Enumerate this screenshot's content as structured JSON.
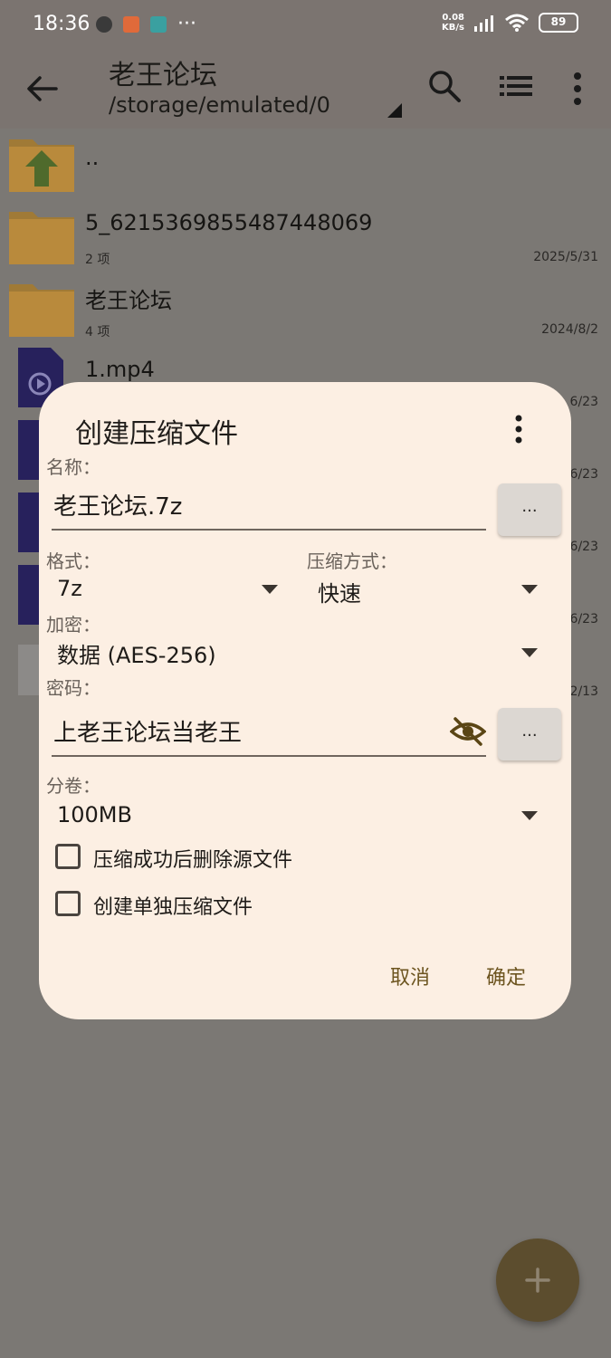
{
  "status_bar": {
    "time": "18:36",
    "net_speed_value": "0.08",
    "net_speed_unit": "KB/s",
    "battery": "89",
    "more_indicator": "···"
  },
  "app_bar": {
    "title": "老王论坛",
    "path": "/storage/emulated/0"
  },
  "files": [
    {
      "name": "..",
      "sub": "",
      "date": "",
      "icon": "folder-up-icon"
    },
    {
      "name": "5_6215369855487448069",
      "sub": "2 项",
      "date": "2025/5/31",
      "icon": "folder-icon"
    },
    {
      "name": "老王论坛",
      "sub": "4 项",
      "date": "2024/8/2",
      "icon": "folder-icon"
    },
    {
      "name": "1.mp4",
      "sub": "",
      "date": "6/23",
      "icon": "video-file-icon"
    },
    {
      "name": "",
      "sub": "",
      "date": "6/23",
      "icon": "video-file-icon"
    },
    {
      "name": "",
      "sub": "",
      "date": "6/23",
      "icon": "video-file-icon"
    },
    {
      "name": "",
      "sub": "",
      "date": "6/23",
      "icon": "video-file-icon"
    },
    {
      "name": "",
      "sub": "",
      "date": "2/13",
      "icon": "image-file-icon"
    }
  ],
  "dialog": {
    "title": "创建压缩文件",
    "name_label": "名称：",
    "name_value": "老王论坛.7z",
    "dots_label": "...",
    "format_label": "格式：",
    "format_value": "7z",
    "method_label": "压缩方式：",
    "method_value": "快速",
    "encrypt_label": "加密：",
    "encrypt_value": "数据 (AES-256)",
    "password_label": "密码：",
    "password_value": "上老王论坛当老王",
    "volume_label": "分卷：",
    "volume_value": "100MB",
    "checkbox_delete": "压缩成功后删除源文件",
    "checkbox_separate": "创建单独压缩文件",
    "cancel": "取消",
    "confirm": "确定"
  },
  "colors": {
    "scrim": "#7b7874",
    "dialog_bg": "#fcefe3",
    "accent": "#6d5520",
    "folder": "#b98a3c",
    "fab": "#5c4d2e"
  }
}
